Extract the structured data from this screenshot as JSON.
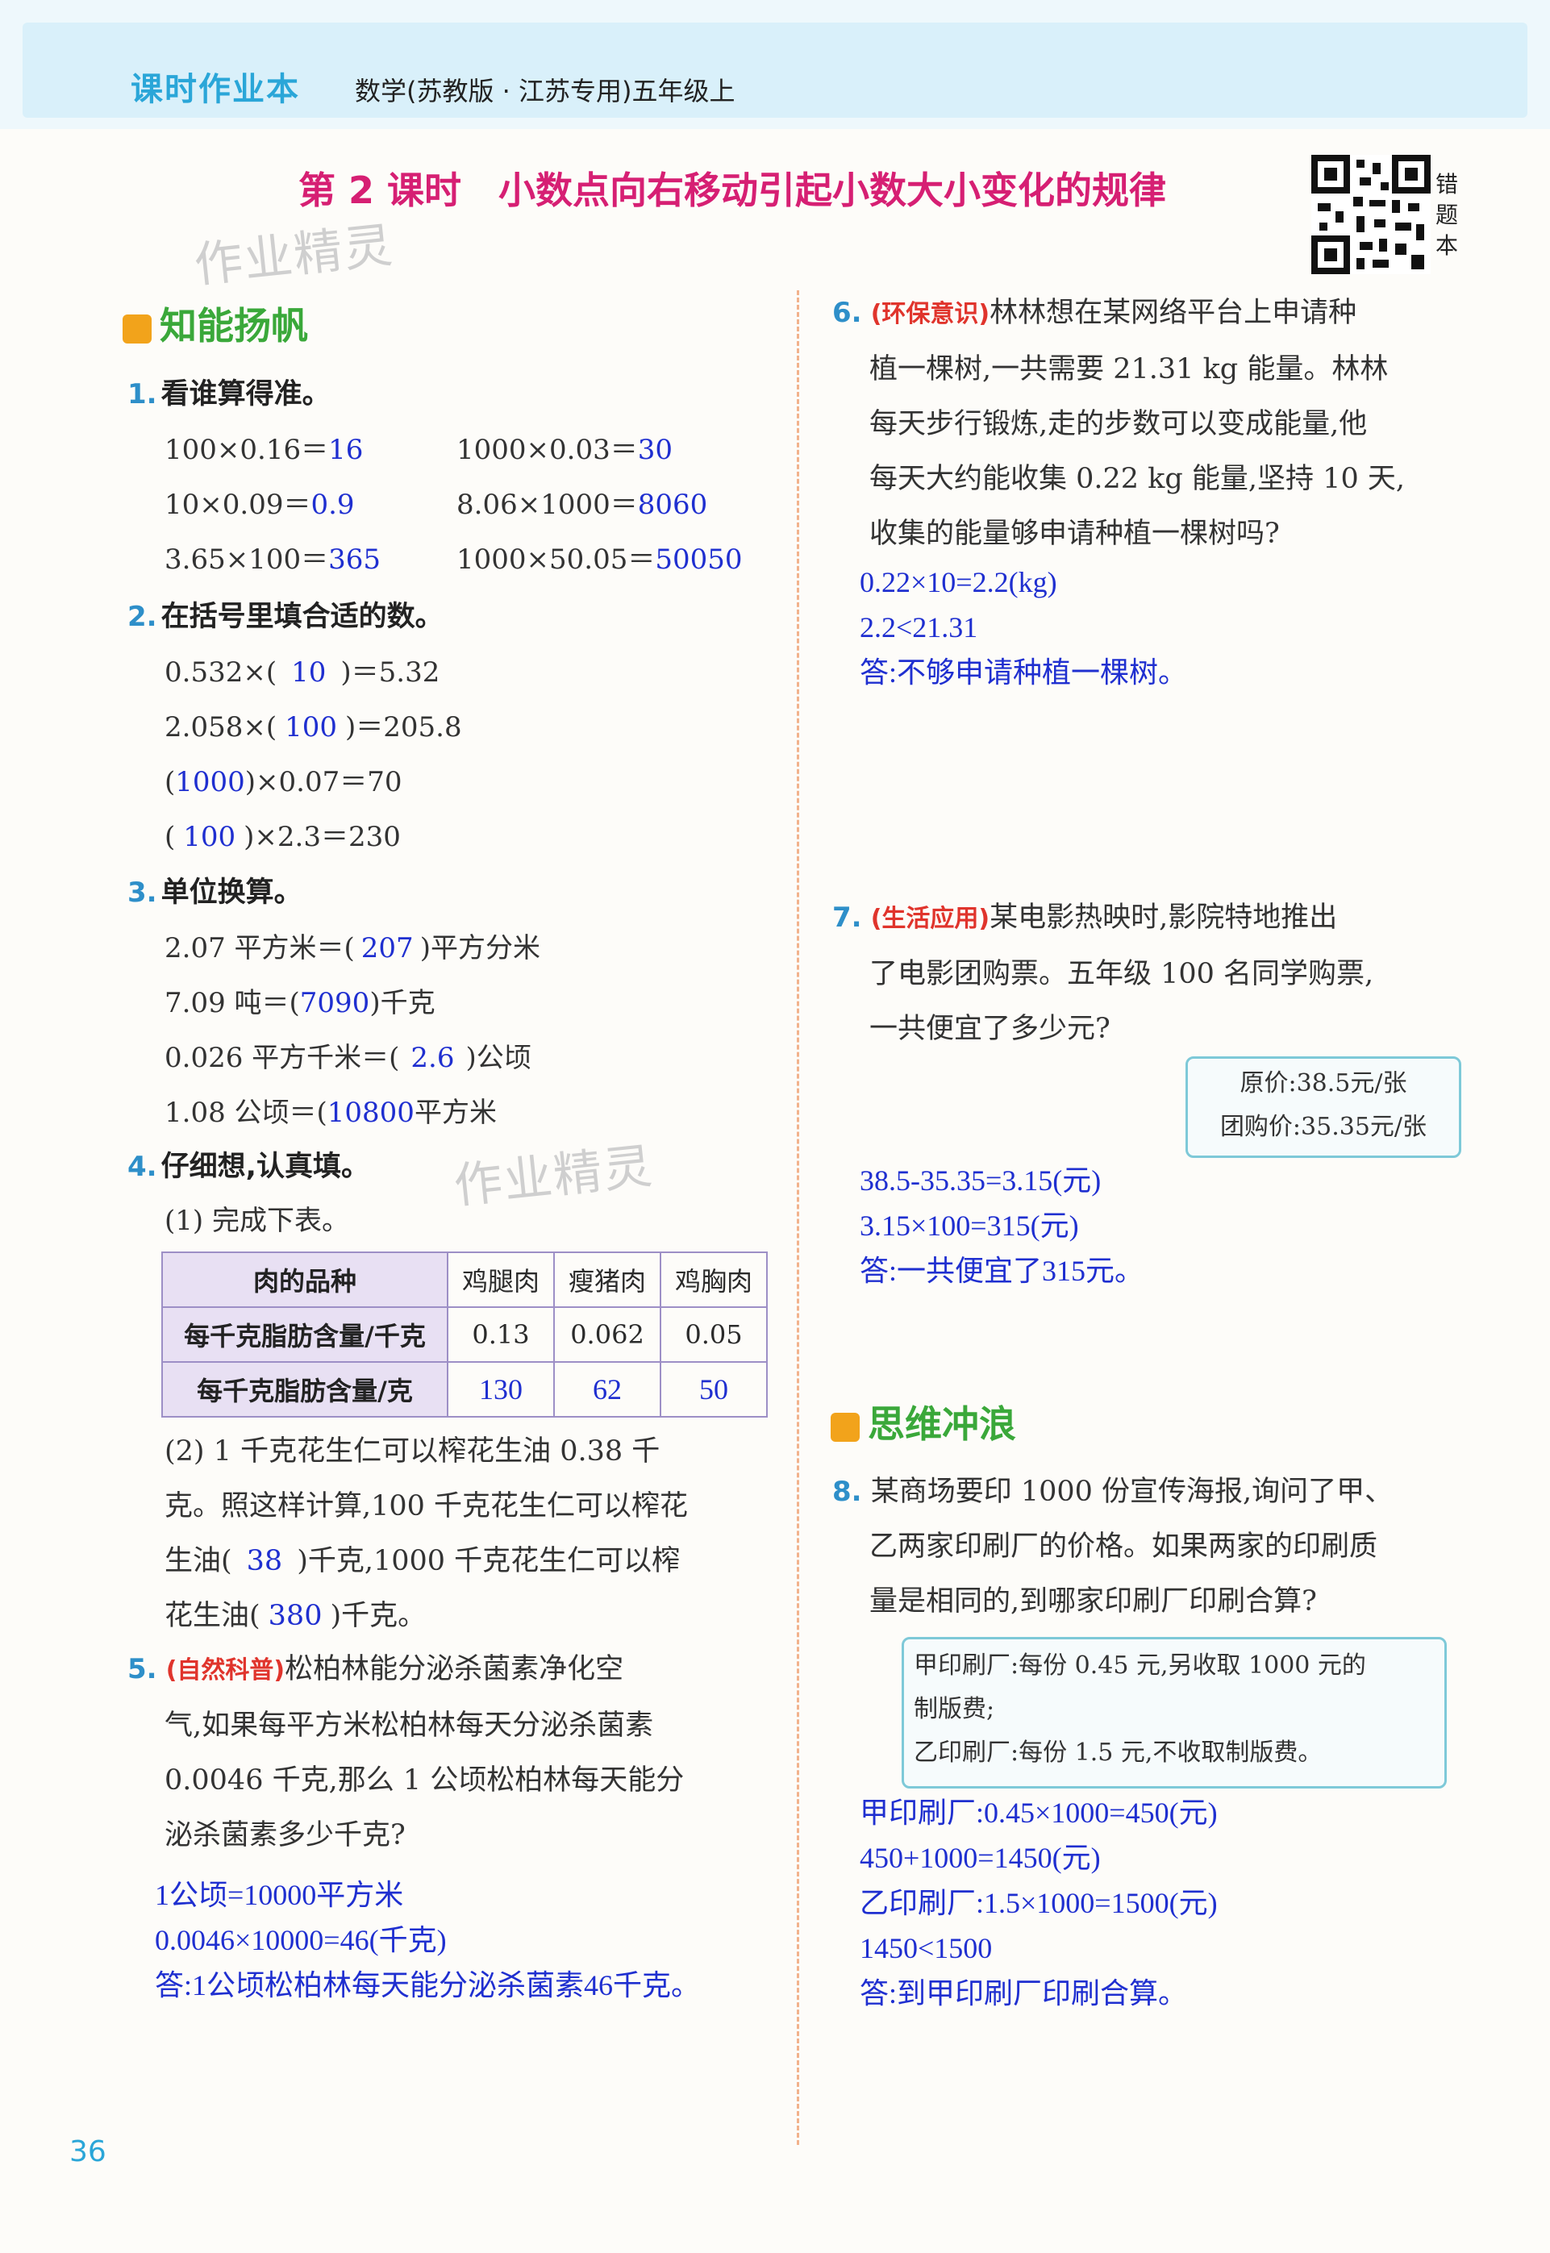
{
  "header": {
    "brand": "课时作业本",
    "book": "数学(苏教版 · 江苏专用)五年级上"
  },
  "lesson_title": "第 2 课时　小数点向右移动引起小数大小变化的规律",
  "qr_label": "错题本",
  "watermark": "作业精灵",
  "sections": {
    "s1": "知能扬帆",
    "s2": "思维冲浪"
  },
  "q1": {
    "num": "1.",
    "title": "看谁算得准。",
    "items": [
      {
        "expr": "100×0.16＝",
        "ans": "16"
      },
      {
        "expr": "1000×0.03＝",
        "ans": "30"
      },
      {
        "expr": "10×0.09＝",
        "ans": "0.9"
      },
      {
        "expr": "8.06×1000＝",
        "ans": "8060"
      },
      {
        "expr": "3.65×100＝",
        "ans": "365"
      },
      {
        "expr": "1000×50.05＝",
        "ans": "50050"
      }
    ]
  },
  "q2": {
    "num": "2.",
    "title": "在括号里填合适的数。",
    "lines": [
      {
        "pre": "0.532×(",
        "ans": "10",
        "post": ")＝5.32"
      },
      {
        "pre": "2.058×(",
        "ans": "100",
        "post": ")＝205.8"
      },
      {
        "pre": "(",
        "ans": "1000",
        "post": ")×0.07＝70"
      },
      {
        "pre": "(",
        "ans": "100",
        "post": ")×2.3＝230"
      }
    ]
  },
  "q3": {
    "num": "3.",
    "title": "单位换算。",
    "lines": [
      {
        "pre": "2.07 平方米＝(",
        "ans": "207",
        "post": ")平方分米"
      },
      {
        "pre": "7.09 吨＝(",
        "ans": "7090",
        "post": ")千克"
      },
      {
        "pre": "0.026 平方千米＝(",
        "ans": "2.6",
        "post": ")公顷"
      },
      {
        "pre": "1.08 公顷＝(",
        "ans": "10800",
        "post": "平方米"
      }
    ]
  },
  "q4": {
    "num": "4.",
    "title": "仔细想,认真填。",
    "sub1": "(1) 完成下表。",
    "table": {
      "col0": "肉的品种",
      "cols": [
        "鸡腿肉",
        "瘦猪肉",
        "鸡胸肉"
      ],
      "row1_label": "每千克脂肪含量/千克",
      "row1": [
        "0.13",
        "0.062",
        "0.05"
      ],
      "row2_label": "每千克脂肪含量/克",
      "row2": [
        "130",
        "62",
        "50"
      ]
    },
    "sub2": {
      "l1": "(2) 1 千克花生仁可以榨花生油 0.38 千",
      "l2": "克。照这样计算,100 千克花生仁可以榨花",
      "l3a": "生油(",
      "a1": "38",
      "l3b": ")千克,1000 千克花生仁可以榨",
      "l4a": "花生油(",
      "a2": "380",
      "l4b": ")千克。"
    }
  },
  "q5": {
    "num": "5.",
    "tag": "(自然科普)",
    "lines": [
      "松柏林能分泌杀菌素净化空",
      "气,如果每平方米松柏林每天分泌杀菌素",
      "0.0046 千克,那么 1 公顷松柏林每天能分",
      "泌杀菌素多少千克?"
    ],
    "answers": [
      "1公顷=10000平方米",
      "0.0046×10000=46(千克)",
      "答:1公顷松柏林每天能分泌杀菌素46千克。"
    ]
  },
  "q6": {
    "num": "6.",
    "tag": "(环保意识)",
    "lines": [
      "林林想在某网络平台上申请种",
      "植一棵树,一共需要 21.31 kg 能量。林林",
      "每天步行锻炼,走的步数可以变成能量,他",
      "每天大约能收集 0.22 kg 能量,坚持 10 天,",
      "收集的能量够申请种植一棵树吗?"
    ],
    "answers": [
      "0.22×10=2.2(kg)",
      "2.2<21.31",
      "答:不够申请种植一棵树。"
    ]
  },
  "q7": {
    "num": "7.",
    "tag": "(生活应用)",
    "lines": [
      "某电影热映时,影院特地推出",
      "了电影团购票。五年级 100 名同学购票,",
      "一共便宜了多少元?"
    ],
    "box": [
      "原价:38.5元/张",
      "团购价:35.35元/张"
    ],
    "answers": [
      "38.5-35.35=3.15(元)",
      "3.15×100=315(元)",
      "答:一共便宜了315元。"
    ]
  },
  "q8": {
    "num": "8.",
    "lines": [
      "某商场要印 1000 份宣传海报,询问了甲、",
      "乙两家印刷厂的价格。如果两家的印刷质",
      "量是相同的,到哪家印刷厂印刷合算?"
    ],
    "box": [
      "甲印刷厂:每份 0.45 元,另收取 1000 元的",
      "制版费;",
      "乙印刷厂:每份 1.5 元,不收取制版费。"
    ],
    "answers": [
      "甲印刷厂:0.45×1000=450(元)",
      "450+1000=1450(元)",
      "乙印刷厂:1.5×1000=1500(元)",
      "1450<1500",
      "答:到甲印刷厂印刷合算。"
    ]
  },
  "page_number": "36"
}
